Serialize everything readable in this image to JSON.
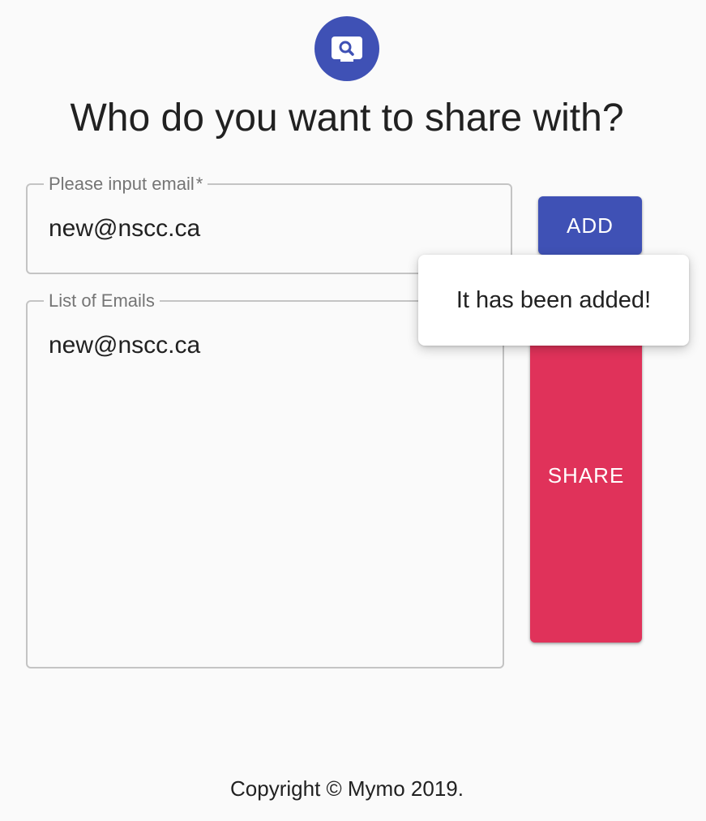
{
  "logo": {
    "icon": "search-icon",
    "color": "#3f51b5"
  },
  "title": "Who do you want to share with?",
  "email_field": {
    "label": "Please input email",
    "required_marker": "*",
    "value": "new@nscc.ca"
  },
  "list_field": {
    "label": "List of Emails",
    "value": "new@nscc.ca"
  },
  "buttons": {
    "add": "ADD",
    "share": "SHARE"
  },
  "colors": {
    "primary": "#3f51b5",
    "secondary": "#e0325a"
  },
  "popover": {
    "message": "It has been added!"
  },
  "footer": {
    "text": "Copyright © Mymo 2019."
  }
}
